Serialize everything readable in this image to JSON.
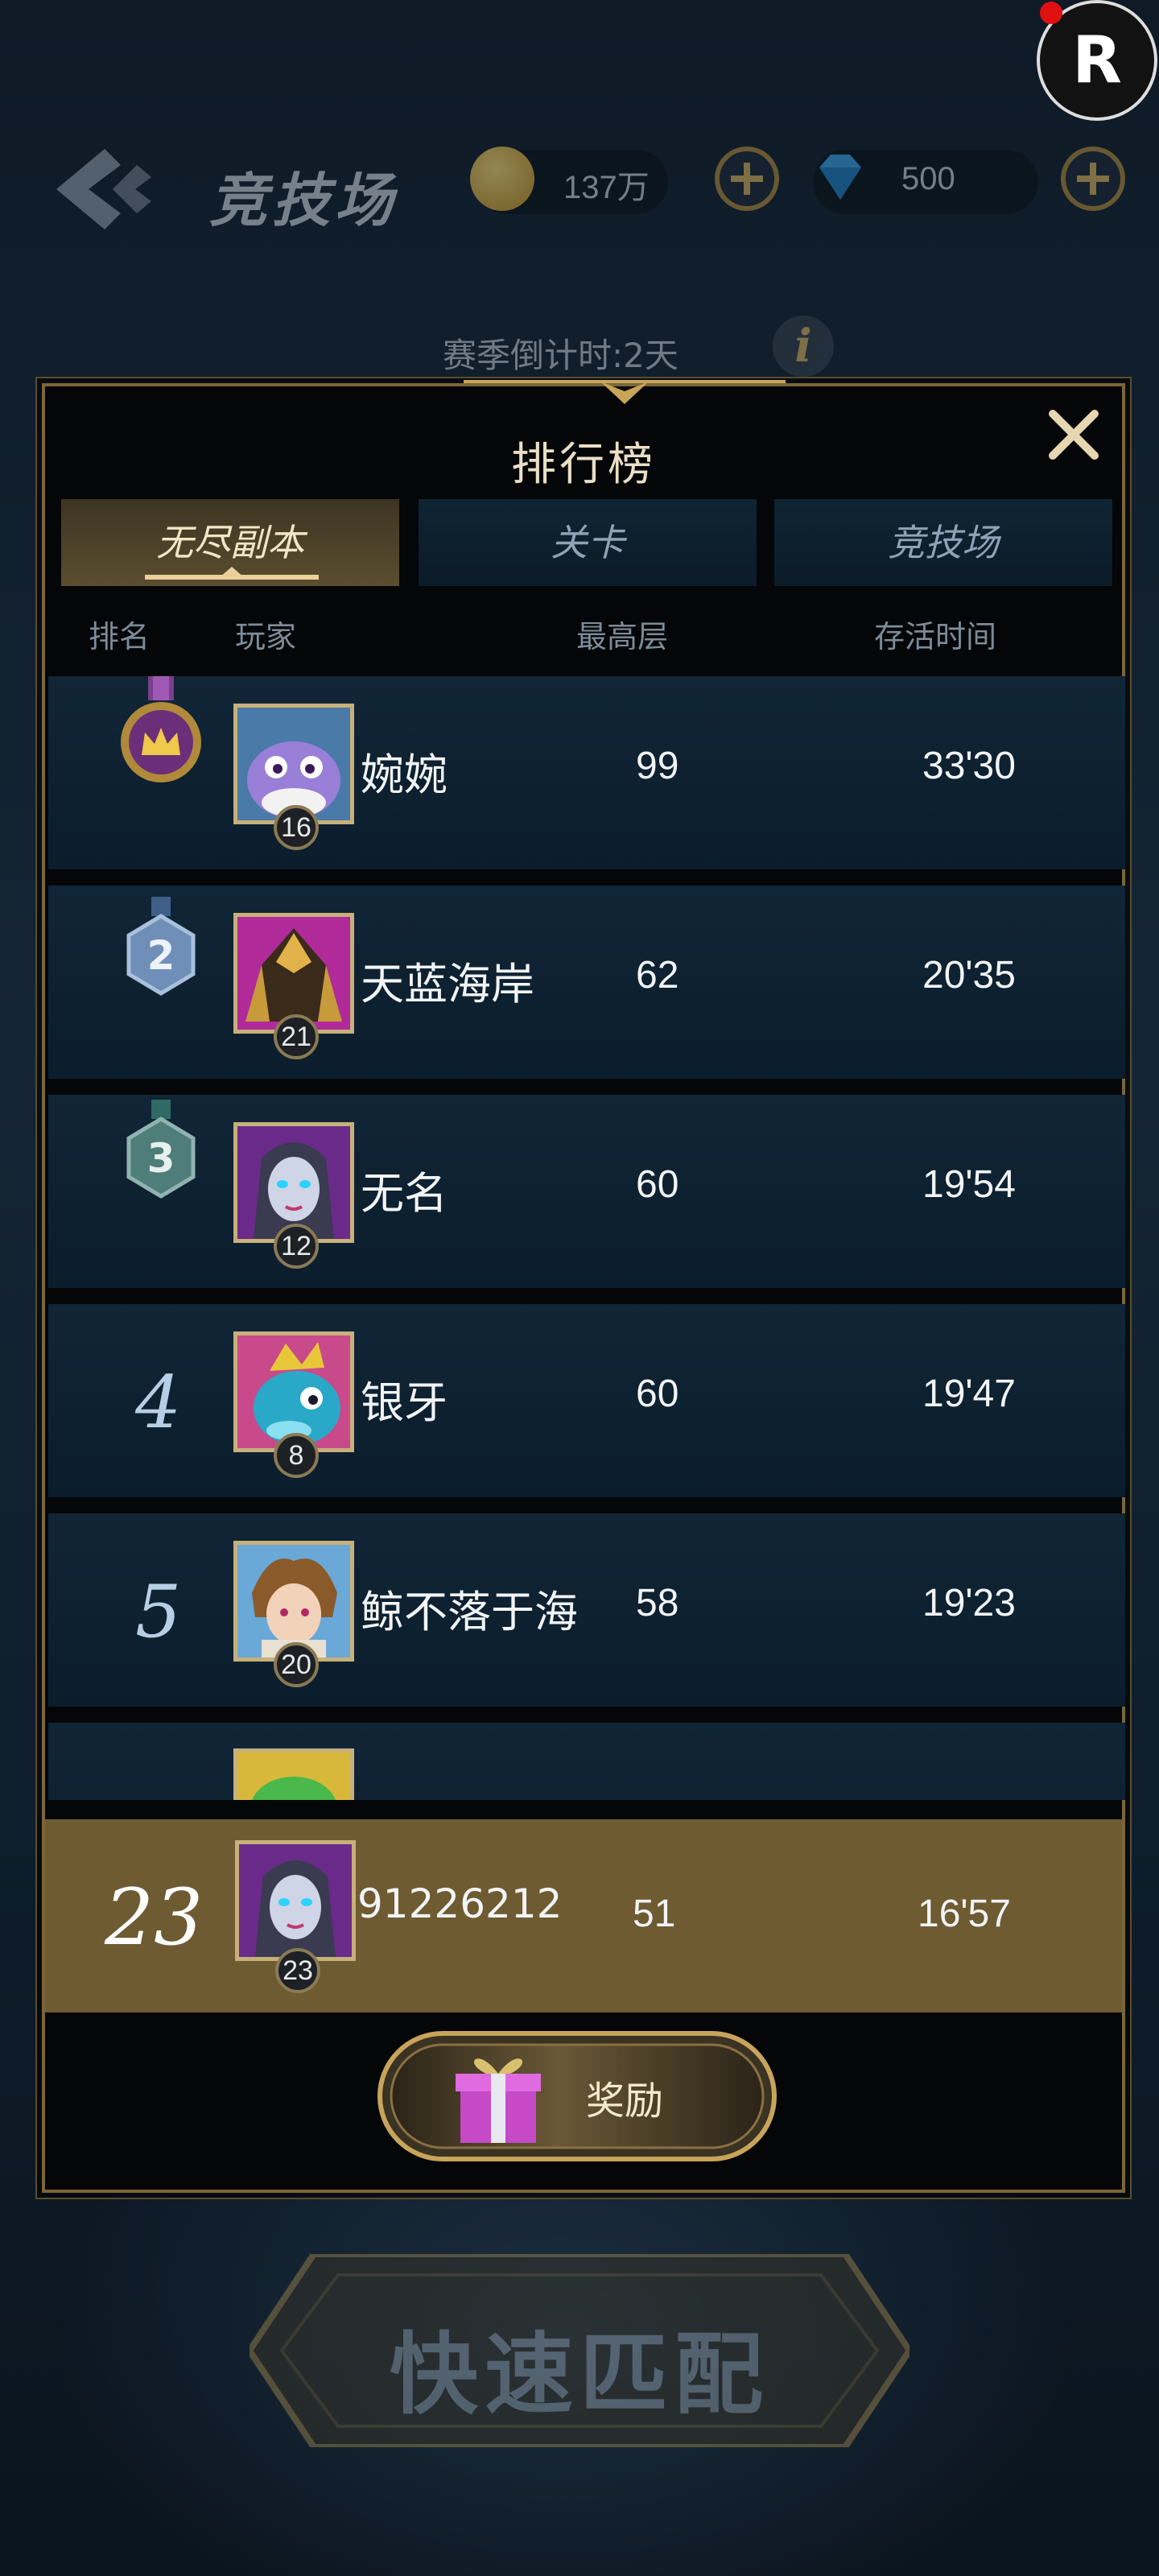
{
  "header": {
    "title": "竞技场",
    "gold": "137万",
    "diamonds": "500",
    "season_countdown": "赛季倒计时:2天"
  },
  "overlay": {
    "record_button": "R"
  },
  "modal": {
    "title": "排行榜",
    "tabs": [
      {
        "label": "无尽副本",
        "active": true
      },
      {
        "label": "关卡",
        "active": false
      },
      {
        "label": "竞技场",
        "active": false
      }
    ],
    "columns": {
      "rank": "排名",
      "player": "玩家",
      "floor": "最高层",
      "time": "存活时间"
    },
    "rows": [
      {
        "rank": "1",
        "name": "婉婉",
        "level": "16",
        "floor": "99",
        "time": "33'30"
      },
      {
        "rank": "2",
        "name": "天蓝海岸",
        "level": "21",
        "floor": "62",
        "time": "20'35"
      },
      {
        "rank": "3",
        "name": "无名",
        "level": "12",
        "floor": "60",
        "time": "19'54"
      },
      {
        "rank": "4",
        "name": "银牙",
        "level": "8",
        "floor": "60",
        "time": "19'47"
      },
      {
        "rank": "5",
        "name": "鲸不落于海",
        "level": "20",
        "floor": "58",
        "time": "19'23"
      }
    ],
    "my_row": {
      "rank": "23",
      "name": "91226212",
      "level": "23",
      "floor": "51",
      "time": "16'57"
    },
    "reward_button": "奖励"
  },
  "quick_match": "快速匹配",
  "colors": {
    "gold": "#c7a45a",
    "row_bg": "#0e2131",
    "my_row_bg": "#6e5b32",
    "accent_text": "#eadfc4"
  }
}
